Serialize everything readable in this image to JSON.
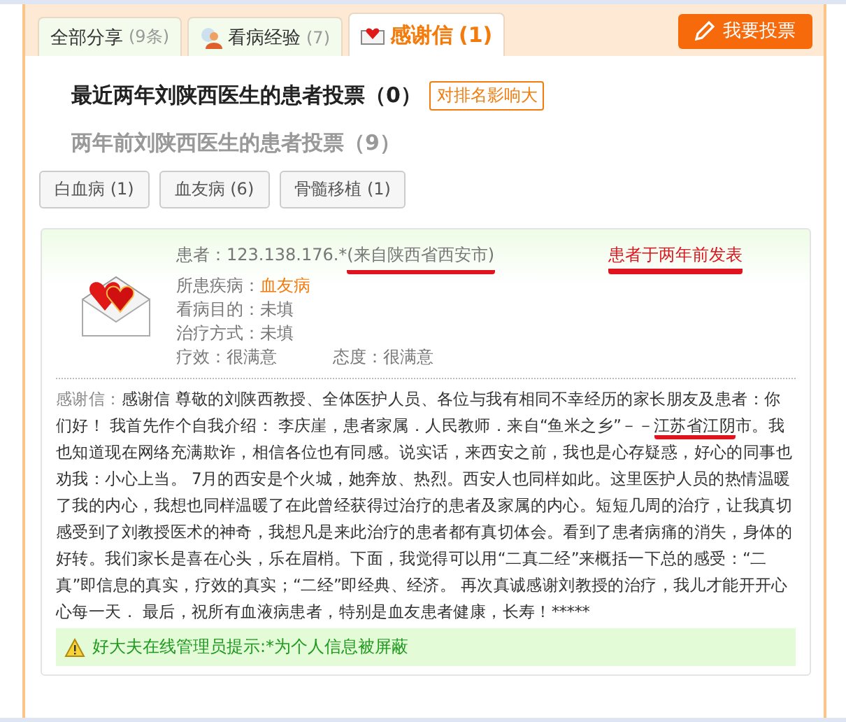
{
  "tabs": [
    {
      "label": "全部分享",
      "count": "(9条)",
      "kind": "plain",
      "selected": false
    },
    {
      "label": "看病经验",
      "count": "(7)",
      "kind": "person",
      "selected": false
    },
    {
      "label": "感谢信",
      "count": "(1)",
      "kind": "letter",
      "selected": true
    }
  ],
  "vote_button": "我要投票",
  "recent_votes": {
    "title": "最近两年刘陕西医生的患者投票（0）",
    "badge": "对排名影响大"
  },
  "older_votes": {
    "title": "两年前刘陕西医生的患者投票（9）"
  },
  "filters": [
    {
      "label": "白血病 (1)",
      "selected": false
    },
    {
      "label": "血友病 (6)",
      "selected": false
    },
    {
      "label": "骨髓移植 (1)",
      "selected": false
    }
  ],
  "post": {
    "patient_label": "患者：",
    "patient_ip": "123.138.176.*",
    "patient_origin": "(来自陕西省西安市)",
    "published": "患者于两年前发表",
    "fields": [
      {
        "label": "所患疾病：",
        "value": "血友病",
        "kind": "link"
      },
      {
        "label": "看病目的：",
        "value": "未填",
        "kind": "plain"
      },
      {
        "label": "治疗方式：",
        "value": "未填",
        "kind": "plain"
      }
    ],
    "efficacy_label": "疗效：",
    "efficacy": "很满意",
    "attitude_label": "态度：",
    "attitude": "很满意",
    "letter_label": "感谢信：",
    "letter": [
      {
        "text": "感谢信  尊敬的刘陕西教授、全体医护人员、各位与我有相同不幸经历的家长朋友及患者：你们好！  我首先作个自我介绍：  李庆崖，患者家属．人民教师．来自“鱼米之乡”－－",
        "marked": false
      },
      {
        "text": "江苏省江阴",
        "marked": true
      },
      {
        "text": "市。我也知道现在网络充满欺诈，相信各位也有同感。说实话，来西安之前，我也是心存疑惑，好心的同事也劝我：小心上当。  7月的西安是个火城，她奔放、热烈。西安人也同样如此。这里医护人员的热情温暖了我的内心，我想也同样温暖了在此曾经获得过治疗的患者及家属的内心。短短几周的治疗，让我真切感受到了刘教授医术的神奇，我想凡是来此治疗的患者都有真切体会。看到了患者病痛的消失，身体的好转。我们家长是喜在心头，乐在眉梢。下面，我觉得可以用“二真二经”来概括一下总的感受：“二真”即信息的真实，疗效的真实；“二经”即经典、经济。  再次真诚感谢刘教授的治疗，我儿才能开开心心每一天．  最后，祝所有血液病患者，特别是血友患者健康，长寿！*****",
        "marked": false
      }
    ],
    "notice": "好大夫在线管理员提示:*为个人信息被屏蔽"
  }
}
